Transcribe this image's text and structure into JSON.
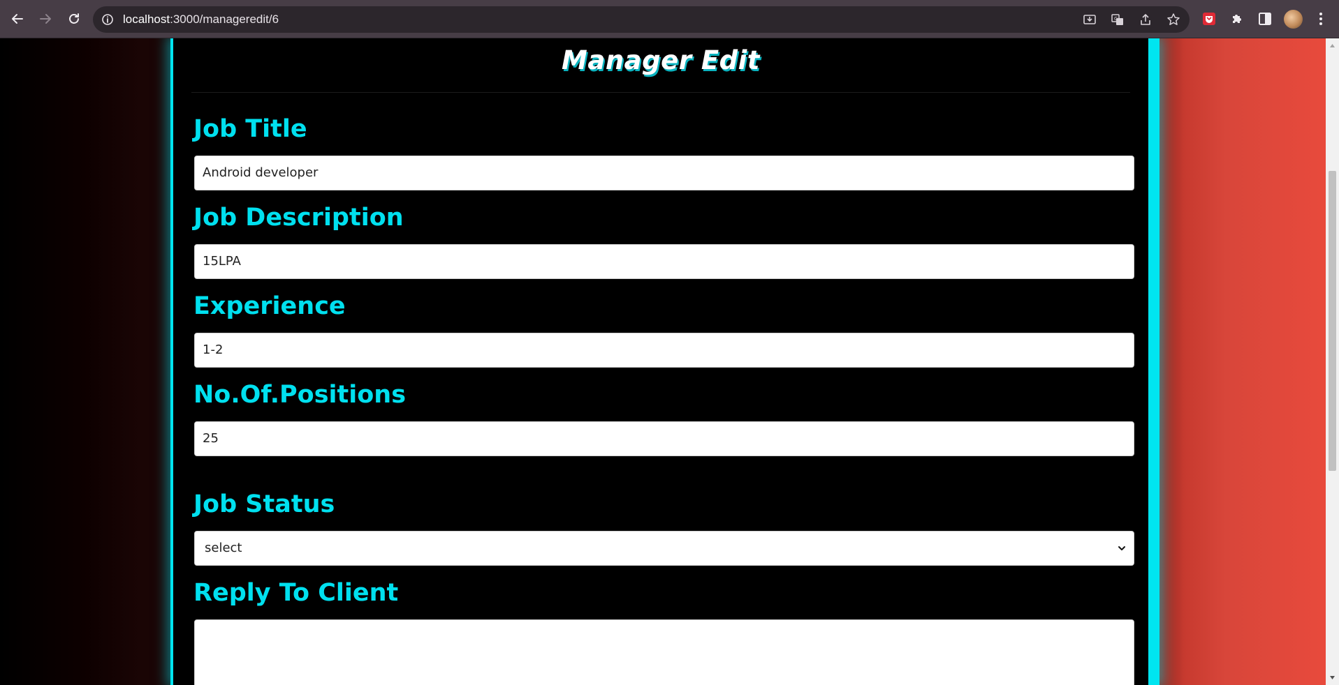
{
  "browser": {
    "url_host": "localhost",
    "url_path": ":3000/manageredit/6",
    "icons": {
      "back": "arrow-left-icon",
      "forward": "arrow-right-icon",
      "reload": "reload-icon",
      "site_info": "info-icon",
      "install": "install-icon",
      "translate": "translate-icon",
      "share": "share-icon",
      "bookmark": "star-icon",
      "extension_pin": "shield-extension-icon",
      "extensions": "puzzle-icon",
      "side_panel": "side-panel-icon",
      "menu": "kebab-menu-icon"
    }
  },
  "page": {
    "title": "Manager Edit",
    "fields": {
      "job_title": {
        "label": "Job Title",
        "value": "Android developer"
      },
      "job_description": {
        "label": "Job Description",
        "value": "15LPA"
      },
      "experience": {
        "label": "Experience",
        "value": "1-2"
      },
      "positions": {
        "label": "No.Of.Positions",
        "value": "25"
      },
      "job_status": {
        "label": "Job Status",
        "selected": "select"
      },
      "reply": {
        "label": "Reply To Client",
        "value": ""
      }
    }
  },
  "colors": {
    "accent_cyan": "#00e0ef",
    "chrome_bg": "#473d46",
    "right_background": "#e84a3c",
    "page_bg": "#000000"
  }
}
